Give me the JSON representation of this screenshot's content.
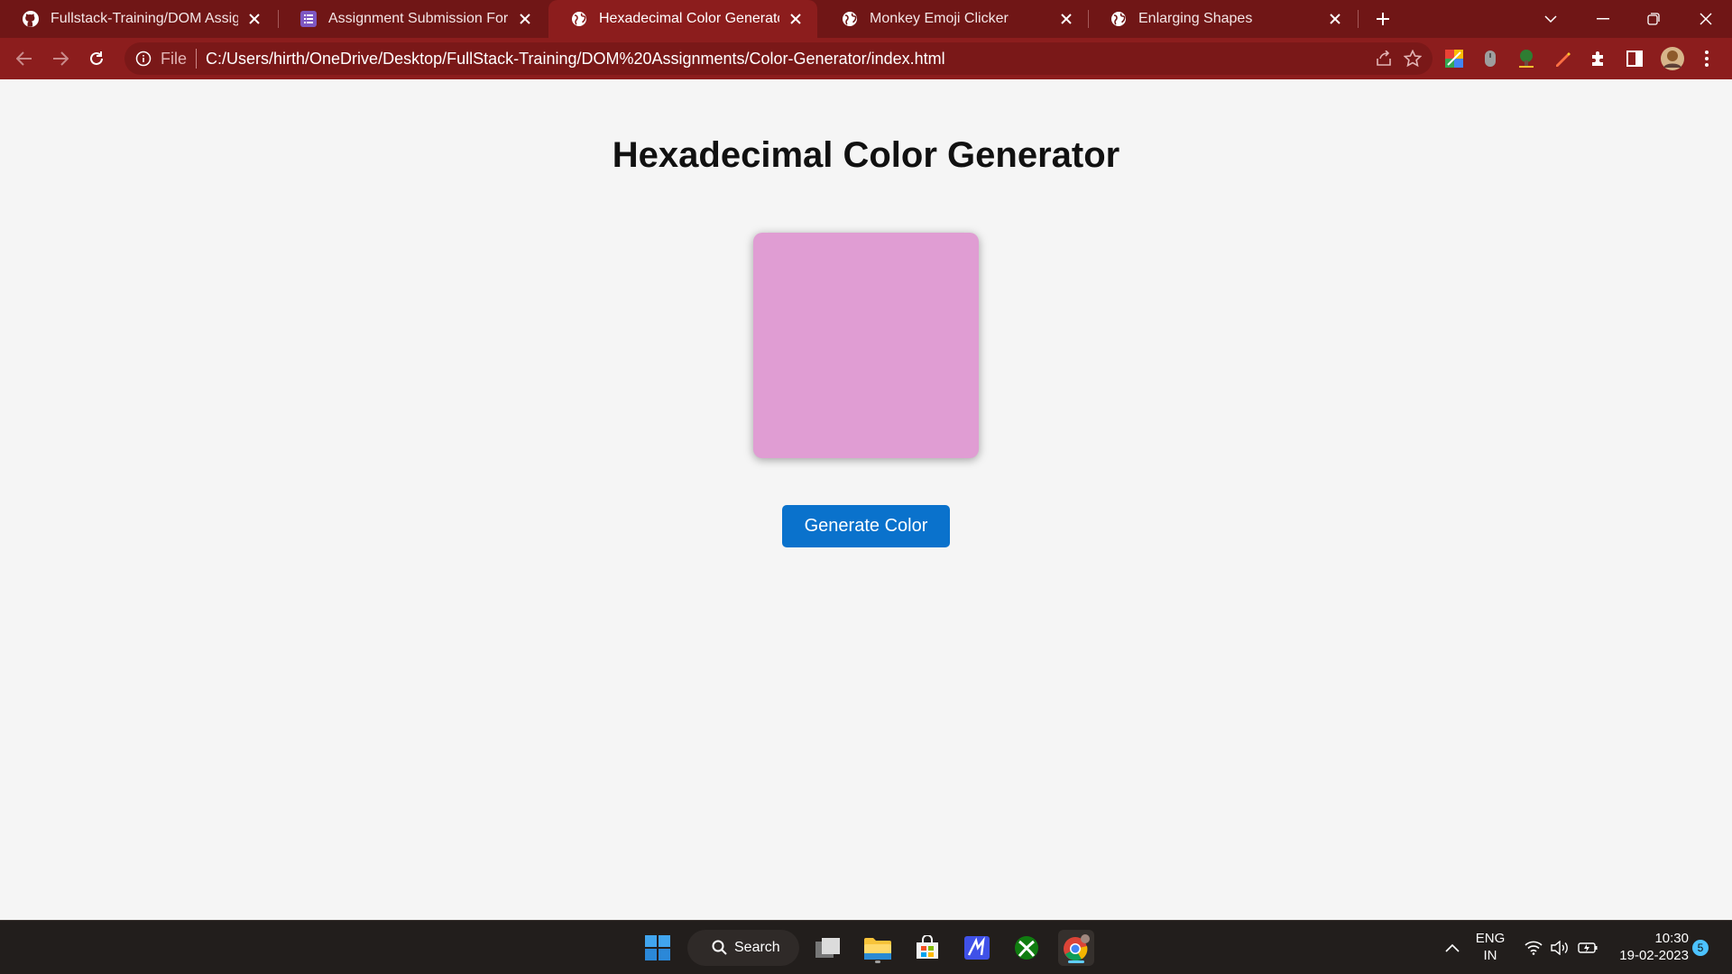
{
  "browser": {
    "tabs": [
      {
        "title": "Fullstack-Training/DOM Assignments",
        "icon": "github-icon",
        "active": false
      },
      {
        "title": "Assignment Submission Form-17",
        "icon": "form-icon",
        "active": false
      },
      {
        "title": "Hexadecimal Color Generator",
        "icon": "globe-icon",
        "active": true
      },
      {
        "title": "Monkey Emoji Clicker",
        "icon": "globe-icon",
        "active": false
      },
      {
        "title": "Enlarging Shapes",
        "icon": "globe-icon",
        "active": false
      }
    ],
    "address_bar": {
      "scheme_chip": "File",
      "url": "C:/Users/hirth/OneDrive/Desktop/FullStack-Training/DOM%20Assignments/Color-Generator/index.html"
    },
    "theme_colors": {
      "tabstrip": "#701616",
      "toolbar": "#8c1d1d",
      "omnibox": "#7a1818"
    }
  },
  "page": {
    "title": "Hexadecimal Color Generator",
    "color_box": {
      "color": "#e09dd3"
    },
    "generate_button_label": "Generate Color",
    "button_color": "#0a72cc",
    "background": "#f5f5f5"
  },
  "taskbar": {
    "search_label": "Search",
    "language": {
      "line1": "ENG",
      "line2": "IN"
    },
    "time": "10:30",
    "date": "19-02-2023",
    "notification_count": "5"
  }
}
